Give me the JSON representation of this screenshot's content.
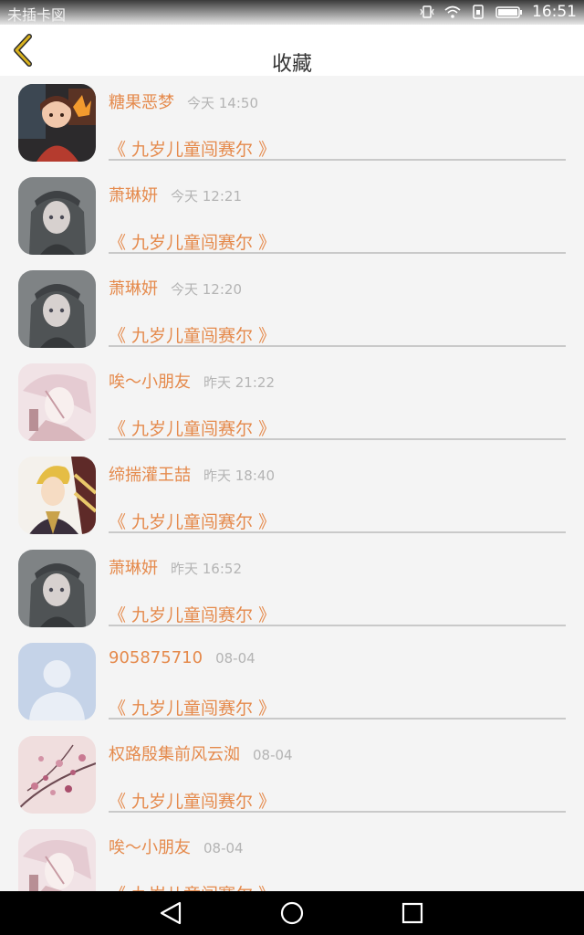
{
  "status_bar": {
    "carrier": "未插卡図",
    "time": "16:51"
  },
  "header": {
    "title": "收藏"
  },
  "items": [
    {
      "name": "糖果恶梦",
      "time": "今天 14:50",
      "book": "《 九岁儿童闯赛尔 》",
      "avatar": "anime-girl-fire-avatar"
    },
    {
      "name": "萧琳妍",
      "time": "今天 12:21",
      "book": "《 九岁儿童闯赛尔 》",
      "avatar": "gray-hat-girl-avatar"
    },
    {
      "name": "萧琳妍",
      "time": "今天 12:20",
      "book": "《 九岁儿童闯赛尔 》",
      "avatar": "gray-hat-girl-avatar"
    },
    {
      "name": "唉～小朋友",
      "time": "昨天 21:22",
      "book": "《 九岁儿童闯赛尔 》",
      "avatar": "pink-boy-avatar"
    },
    {
      "name": "缔揣灌王喆",
      "time": "昨天 18:40",
      "book": "《 九岁儿童闯赛尔 》",
      "avatar": "blonde-boy-avatar"
    },
    {
      "name": "萧琳妍",
      "time": "昨天 16:52",
      "book": "《 九岁儿童闯赛尔 》",
      "avatar": "gray-hat-girl-avatar"
    },
    {
      "name": "905875710",
      "time": "08-04",
      "book": "《 九岁儿童闯赛尔 》",
      "avatar": "default-user-avatar"
    },
    {
      "name": "权路殷集前风云洳",
      "time": "08-04",
      "book": "《 九岁儿童闯赛尔 》",
      "avatar": "pink-blossom-avatar"
    },
    {
      "name": "唉～小朋友",
      "time": "08-04",
      "book": "《 九岁儿童闯赛尔 》",
      "avatar": "pink-boy-avatar"
    }
  ],
  "colors": {
    "accent": "#e58a4c",
    "back_arrow": "#d9b21f",
    "time_text": "#b4b4b4"
  }
}
